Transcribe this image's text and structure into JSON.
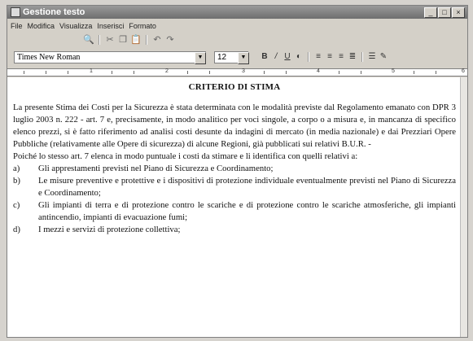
{
  "window": {
    "title": "Gestione testo",
    "controls": [
      "_",
      "□",
      "×"
    ]
  },
  "menu": [
    "File",
    "Modifica",
    "Visualizza",
    "Inserisci",
    "Formato"
  ],
  "toolbar": {
    "font_name": "Times New Roman",
    "font_size": "12"
  },
  "ruler": {
    "numbers": [
      "1",
      "2",
      "3",
      "4",
      "5",
      "6"
    ]
  },
  "document": {
    "title": "CRITERIO DI STIMA",
    "paragraphs": [
      "La presente Stima dei Costi per la Sicurezza è stata determinata con le modalità previste dal Regolamento emanato con DPR 3 luglio 2003 n. 222 - art. 7 e, precisamente, in modo analitico per voci singole, a corpo o a misura e, in mancanza di specifico elenco prezzi, si è fatto riferimento ad analisi costi desunte da indagini di mercato (in media nazionale) e dai Prezziari Opere Pubbliche (relativamente alle Opere di sicurezza) di alcune Regioni, già pubblicati sui relativi B.U.R. -",
      "Poiché lo stesso art. 7 elenca in modo puntuale i costi da stimare e li identifica con quelli relativi a:"
    ],
    "list": [
      {
        "mark": "a)",
        "text": "Gli apprestamenti previsti nel Piano di Sicurezza e Coordinamento;"
      },
      {
        "mark": "b)",
        "text": "Le misure preventive e protettive e i dispositivi di protezione individuale eventualmente previsti nel Piano di Sicurezza e Coordinamento;"
      },
      {
        "mark": "c)",
        "text": "Gli impianti di terra e di protezione contro le scariche e di protezione contro le scariche atmosferiche, gli impianti antincendio, impianti di evacuazione fumi;"
      },
      {
        "mark": "d)",
        "text": "I mezzi e servizi di protezione collettiva;"
      }
    ]
  }
}
